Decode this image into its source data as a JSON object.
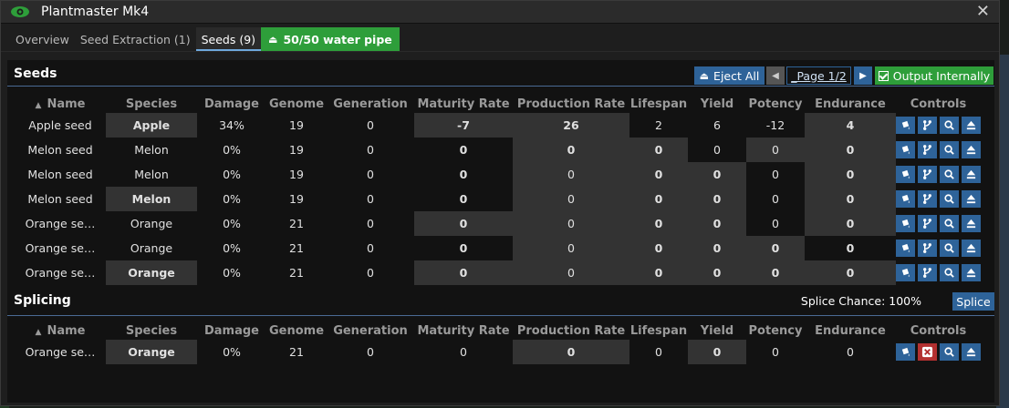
{
  "window": {
    "title": "Plantmaster Mk4",
    "close_glyph": "✕"
  },
  "tabs": [
    {
      "label": "Overview"
    },
    {
      "label": "Seed Extraction (1)"
    },
    {
      "label": "Seeds (9)"
    },
    {
      "label": "50/50 water pipe"
    }
  ],
  "seeds": {
    "title": "Seeds",
    "eject_all": "Eject All",
    "page_label": "_Page 1/2",
    "output_internally": "Output Internally",
    "columns": [
      "Name",
      "Species",
      "Damage",
      "Genome",
      "Generation",
      "Maturity Rate",
      "Production Rate",
      "Lifespan",
      "Yield",
      "Potency",
      "Endurance",
      "Controls"
    ],
    "rows": [
      {
        "name": "Apple seed",
        "species": "Apple",
        "damage": "34%",
        "genome": "19",
        "generation": "0",
        "maturity": "-7",
        "production": "26",
        "lifespan": "2",
        "yield": "6",
        "potency": "-12",
        "endurance": "4"
      },
      {
        "name": "Melon seed",
        "species": "Melon",
        "damage": "0%",
        "genome": "19",
        "generation": "0",
        "maturity": "0",
        "production": "0",
        "lifespan": "0",
        "yield": "0",
        "potency": "0",
        "endurance": "0"
      },
      {
        "name": "Melon seed",
        "species": "Melon",
        "damage": "0%",
        "genome": "19",
        "generation": "0",
        "maturity": "0",
        "production": "0",
        "lifespan": "0",
        "yield": "0",
        "potency": "0",
        "endurance": "0"
      },
      {
        "name": "Melon seed",
        "species": "Melon",
        "damage": "0%",
        "genome": "19",
        "generation": "0",
        "maturity": "0",
        "production": "0",
        "lifespan": "0",
        "yield": "0",
        "potency": "0",
        "endurance": "0"
      },
      {
        "name": "Orange se…",
        "species": "Orange",
        "damage": "0%",
        "genome": "21",
        "generation": "0",
        "maturity": "0",
        "production": "0",
        "lifespan": "0",
        "yield": "0",
        "potency": "0",
        "endurance": "0"
      },
      {
        "name": "Orange se…",
        "species": "Orange",
        "damage": "0%",
        "genome": "21",
        "generation": "0",
        "maturity": "0",
        "production": "0",
        "lifespan": "0",
        "yield": "0",
        "potency": "0",
        "endurance": "0"
      },
      {
        "name": "Orange se…",
        "species": "Orange",
        "damage": "0%",
        "genome": "21",
        "generation": "0",
        "maturity": "0",
        "production": "0",
        "lifespan": "0",
        "yield": "0",
        "potency": "0",
        "endurance": "0"
      }
    ]
  },
  "splicing": {
    "title": "Splicing",
    "chance_label": "Splice Chance: 100%",
    "splice_button": "Splice",
    "columns": [
      "Name",
      "Species",
      "Damage",
      "Genome",
      "Generation",
      "Maturity Rate",
      "Production Rate",
      "Lifespan",
      "Yield",
      "Potency",
      "Endurance",
      "Controls"
    ],
    "rows": [
      {
        "name": "Orange se…",
        "species": "Orange",
        "damage": "0%",
        "genome": "21",
        "generation": "0",
        "maturity": "0",
        "production": "0",
        "lifespan": "0",
        "yield": "0",
        "potency": "0",
        "endurance": "0"
      }
    ]
  },
  "icons": {
    "seed_controls": [
      "bucket-icon",
      "branch-icon",
      "magnify-icon",
      "eject-icon"
    ],
    "splice_controls": [
      "bucket-icon",
      "remove-icon",
      "magnify-icon",
      "eject-icon"
    ]
  },
  "colors": {
    "accent_blue": "#2e6399",
    "accent_green": "#2e9e3a",
    "highlight": "#333333",
    "remove_red": "#b33030"
  }
}
